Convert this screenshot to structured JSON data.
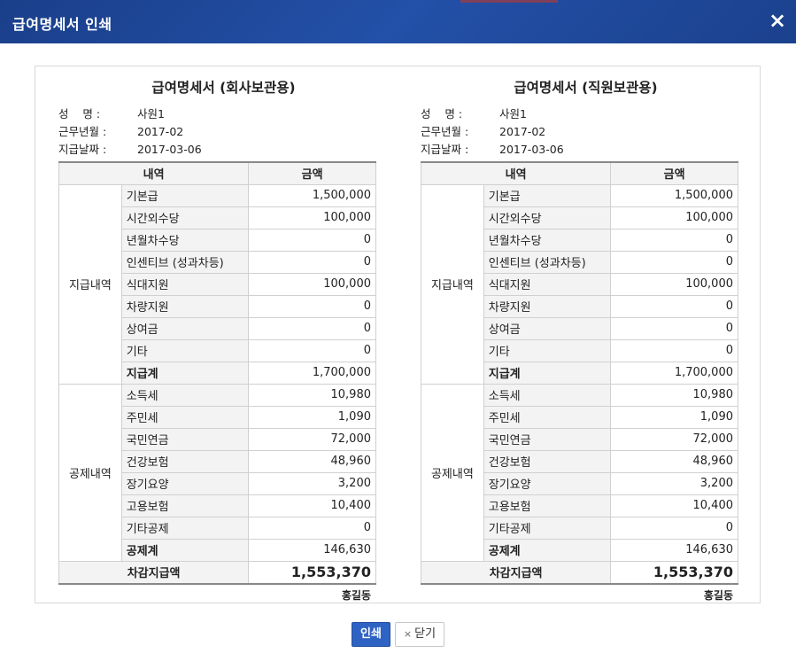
{
  "window": {
    "title": "급여명세서 인쇄",
    "close_icon": "×"
  },
  "slips": [
    {
      "title": "급여명세서 (회사보관용)",
      "info": [
        {
          "label": "성    명 :",
          "value": "사원1"
        },
        {
          "label": "근무년월 :",
          "value": "2017-02"
        },
        {
          "label": "지급날짜 :",
          "value": "2017-03-06"
        }
      ],
      "headers": [
        "내역",
        "금액"
      ],
      "earnings": {
        "category": "지급내역",
        "items": [
          {
            "name": "기본급",
            "amount": "1,500,000"
          },
          {
            "name": "시간외수당",
            "amount": "100,000"
          },
          {
            "name": "년월차수당",
            "amount": "0"
          },
          {
            "name": "인센티브 (성과차등)",
            "amount": "0"
          },
          {
            "name": "식대지원",
            "amount": "100,000"
          },
          {
            "name": "차량지원",
            "amount": "0"
          },
          {
            "name": "상여금",
            "amount": "0"
          },
          {
            "name": "기타",
            "amount": "0"
          }
        ],
        "total_label": "지급계",
        "total": "1,700,000"
      },
      "deductions": {
        "category": "공제내역",
        "items": [
          {
            "name": "소득세",
            "amount": "10,980"
          },
          {
            "name": "주민세",
            "amount": "1,090"
          },
          {
            "name": "국민연금",
            "amount": "72,000"
          },
          {
            "name": "건강보험",
            "amount": "48,960"
          },
          {
            "name": "장기요양",
            "amount": "3,200"
          },
          {
            "name": "고용보험",
            "amount": "10,400"
          },
          {
            "name": "기타공제",
            "amount": "0"
          }
        ],
        "total_label": "공제계",
        "total": "146,630"
      },
      "net_label": "차감지급액",
      "net": "1,553,370",
      "signer": "홍길동"
    },
    {
      "title": "급여명세서 (직원보관용)",
      "info": [
        {
          "label": "성    명 :",
          "value": "사원1"
        },
        {
          "label": "근무년월 :",
          "value": "2017-02"
        },
        {
          "label": "지급날짜 :",
          "value": "2017-03-06"
        }
      ],
      "headers": [
        "내역",
        "금액"
      ],
      "earnings": {
        "category": "지급내역",
        "items": [
          {
            "name": "기본급",
            "amount": "1,500,000"
          },
          {
            "name": "시간외수당",
            "amount": "100,000"
          },
          {
            "name": "년월차수당",
            "amount": "0"
          },
          {
            "name": "인센티브 (성과차등)",
            "amount": "0"
          },
          {
            "name": "식대지원",
            "amount": "100,000"
          },
          {
            "name": "차량지원",
            "amount": "0"
          },
          {
            "name": "상여금",
            "amount": "0"
          },
          {
            "name": "기타",
            "amount": "0"
          }
        ],
        "total_label": "지급계",
        "total": "1,700,000"
      },
      "deductions": {
        "category": "공제내역",
        "items": [
          {
            "name": "소득세",
            "amount": "10,980"
          },
          {
            "name": "주민세",
            "amount": "1,090"
          },
          {
            "name": "국민연금",
            "amount": "72,000"
          },
          {
            "name": "건강보험",
            "amount": "48,960"
          },
          {
            "name": "장기요양",
            "amount": "3,200"
          },
          {
            "name": "고용보험",
            "amount": "10,400"
          },
          {
            "name": "기타공제",
            "amount": "0"
          }
        ],
        "total_label": "공제계",
        "total": "146,630"
      },
      "net_label": "차감지급액",
      "net": "1,553,370",
      "signer": "홍길동"
    }
  ],
  "buttons": {
    "print_label": "인쇄",
    "close_icon": "×",
    "close_label": "닫기"
  },
  "colors": {
    "titlebar": "#1f4a9c",
    "print_button": "#2e63c4"
  }
}
